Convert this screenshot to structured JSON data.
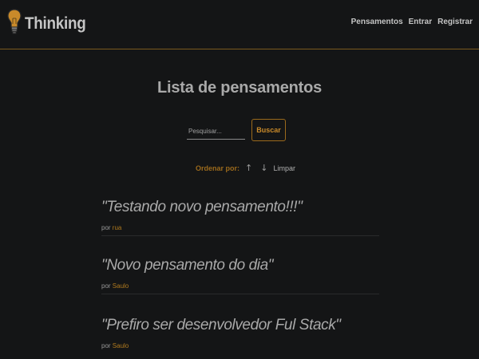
{
  "header": {
    "brand": "Thinking",
    "brand_icon": "lightbulb-icon",
    "nav": [
      "Pensamentos",
      "Entrar",
      "Registrar"
    ]
  },
  "main": {
    "title": "Lista de pensamentos",
    "search": {
      "placeholder": "Pesquisar...",
      "value": "",
      "button": "Buscar"
    },
    "order": {
      "label": "Ordenar por:",
      "asc_icon": "↑",
      "desc_icon": "↓",
      "clear": "Limpar"
    },
    "thoughts": [
      {
        "quote": "\"Testando novo pensamento!!!\"",
        "by": "por",
        "author": "rua"
      },
      {
        "quote": "\"Novo pensamento do dia\"",
        "by": "por",
        "author": "Saulo"
      },
      {
        "quote": "\"Prefiro ser desenvolvedor Ful Stack\"",
        "by": "por",
        "author": "Saulo"
      }
    ]
  },
  "colors": {
    "background": "#141516",
    "accent": "#9b6a1c",
    "text": "#b9b9b9"
  }
}
